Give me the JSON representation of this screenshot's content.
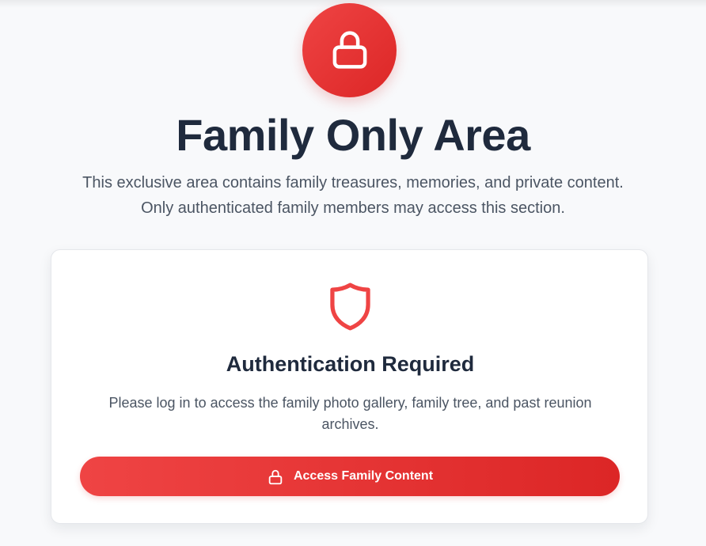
{
  "hero": {
    "icon": "lock-icon",
    "title": "Family Only Area",
    "description_line1": "This exclusive area contains family treasures, memories, and private content.",
    "description_line2": "Only authenticated family members may access this section."
  },
  "auth_card": {
    "icon": "shield-icon",
    "title": "Authentication Required",
    "text_line1": "Please log in to access the family photo gallery, family tree, and past reunion",
    "text_line2": "archives.",
    "button": {
      "icon": "lock-icon",
      "label": "Access Family Content"
    }
  },
  "colors": {
    "accent": "#ef4444",
    "accent_dark": "#dc2626",
    "heading": "#1f2a3d",
    "body_text": "#4b5563",
    "background": "#f8f9fb"
  }
}
